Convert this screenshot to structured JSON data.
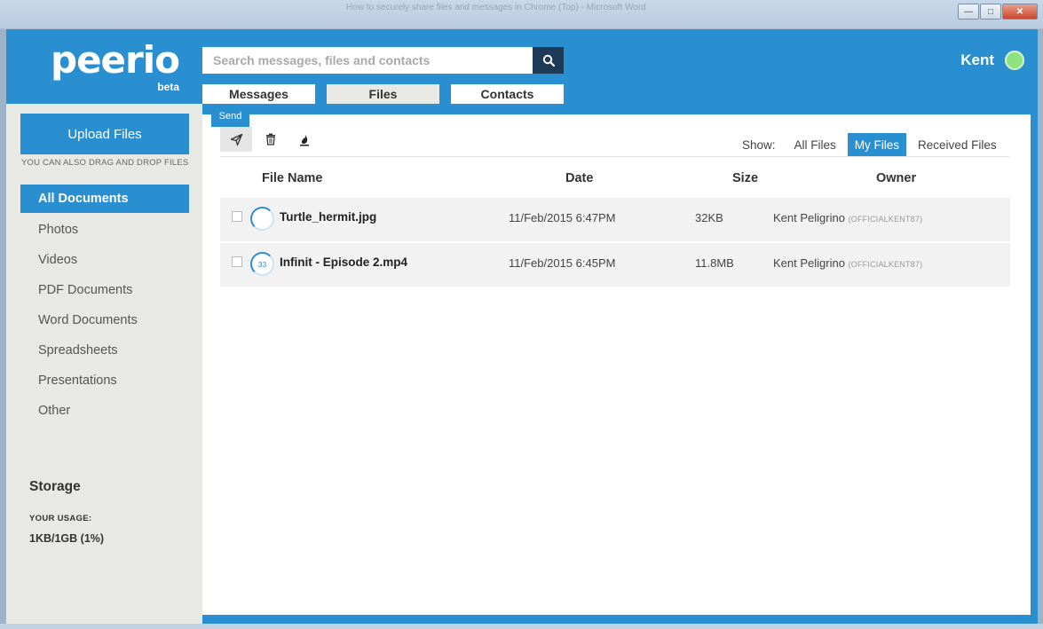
{
  "window": {
    "title": "How to securely share files and messages in Chrome (Top) - Microsoft Word",
    "minimize_icon": "minimize-icon",
    "maximize_icon": "maximize-icon",
    "close_icon": "close-icon"
  },
  "brand": {
    "name": "peerio",
    "tag": "beta",
    "primary_color": "#2a8fd1",
    "dark_color": "#1d3b57",
    "sidebar_bg": "#e8e8e4"
  },
  "search": {
    "placeholder": "Search messages, files and contacts",
    "icon": "search-icon"
  },
  "tabs": [
    {
      "label": "Messages",
      "active": false
    },
    {
      "label": "Files",
      "active": true
    },
    {
      "label": "Contacts",
      "active": false
    }
  ],
  "user": {
    "name": "Kent",
    "status_color": "#8ee27f"
  },
  "sidebar": {
    "upload_label": "Upload Files",
    "drag_note": "YOU CAN ALSO DRAG AND DROP FILES",
    "items": [
      {
        "label": "All Documents",
        "active": true
      },
      {
        "label": "Photos",
        "active": false
      },
      {
        "label": "Videos",
        "active": false
      },
      {
        "label": "PDF Documents",
        "active": false
      },
      {
        "label": "Word Documents",
        "active": false
      },
      {
        "label": "Spreadsheets",
        "active": false
      },
      {
        "label": "Presentations",
        "active": false
      },
      {
        "label": "Other",
        "active": false
      }
    ],
    "storage": {
      "title": "Storage",
      "usage_label": "YOUR USAGE:",
      "usage_value": "1KB/1GB (1%)"
    }
  },
  "toolbar": {
    "tooltip": "Send",
    "send_icon": "send-icon",
    "delete_icon": "trash-icon",
    "burn_icon": "burn-icon",
    "show_label": "Show:",
    "filters": [
      {
        "label": "All Files",
        "active": false
      },
      {
        "label": "My Files",
        "active": true
      },
      {
        "label": "Received Files",
        "active": false
      }
    ]
  },
  "table": {
    "columns": [
      "File Name",
      "Date",
      "Size",
      "Owner"
    ],
    "rows": [
      {
        "name": "Turtle_hermit.jpg",
        "ring_label": "",
        "date": "11/Feb/2015 6:47PM",
        "size": "32KB",
        "owner": "Kent Peligrino",
        "handle": "(OFFICIALKENT87)"
      },
      {
        "name": "Infinit - Episode 2.mp4",
        "ring_label": "33",
        "date": "11/Feb/2015 6:45PM",
        "size": "11.8MB",
        "owner": "Kent Peligrino",
        "handle": "(OFFICIALKENT87)"
      }
    ]
  }
}
